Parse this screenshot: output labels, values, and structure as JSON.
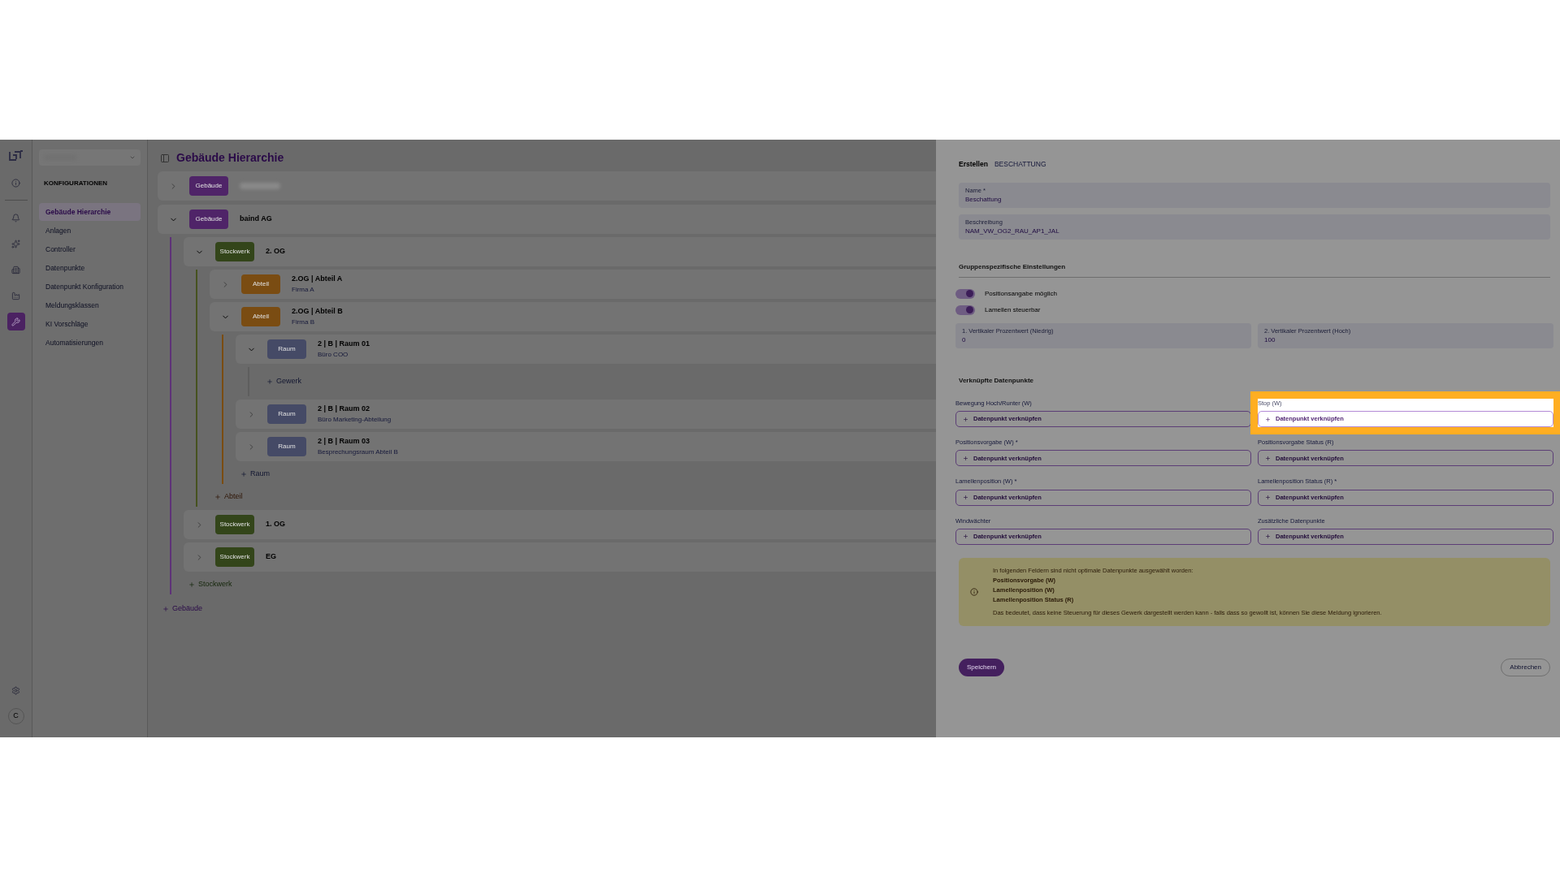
{
  "nav_rail": {
    "items": [
      {
        "kind": "info",
        "selected": false
      },
      {
        "kind": "bell",
        "selected": false
      },
      {
        "kind": "sparkles",
        "selected": false
      },
      {
        "kind": "building",
        "selected": false
      },
      {
        "kind": "factory",
        "selected": false
      },
      {
        "kind": "wrench",
        "selected": true
      }
    ],
    "avatar": "C"
  },
  "nav": {
    "heading": "KONFIGURATIONEN",
    "items": [
      {
        "label": "Gebäude Hierarchie",
        "selected": true
      },
      {
        "label": "Anlagen",
        "selected": false
      },
      {
        "label": "Controller",
        "selected": false
      },
      {
        "label": "Datenpunkte",
        "selected": false
      },
      {
        "label": "Datenpunkt Konfiguration",
        "selected": false
      },
      {
        "label": "Meldungsklassen",
        "selected": false
      },
      {
        "label": "KI Vorschläge",
        "selected": false
      },
      {
        "label": "Automatisierungen",
        "selected": false
      }
    ]
  },
  "page_title": "Gebäude Hierarchie",
  "tree": {
    "nodes": [
      {
        "kind": "gebaeude",
        "badge": "Gebäude",
        "title_redacted": true,
        "expanded": false
      },
      {
        "kind": "gebaeude",
        "badge": "Gebäude",
        "title": "baind AG",
        "expanded": true,
        "add_label": "Stockwerk",
        "children": [
          {
            "kind": "stockwerk",
            "badge": "Stockwerk",
            "title": "2. OG",
            "expanded": true,
            "add_label": "Abteil",
            "children": [
              {
                "kind": "abteil",
                "badge": "Abteil",
                "title": "2.OG | Abteil A",
                "subtitle": "Firma A",
                "expanded": false
              },
              {
                "kind": "abteil",
                "badge": "Abteil",
                "title": "2.OG | Abteil B",
                "subtitle": "Firma B",
                "expanded": true,
                "add_label": "Raum",
                "children": [
                  {
                    "kind": "raum",
                    "badge": "Raum",
                    "title": "2 | B | Raum 01",
                    "subtitle": "Büro COO",
                    "expanded": true,
                    "add_label": "Gewerk"
                  },
                  {
                    "kind": "raum",
                    "badge": "Raum",
                    "title": "2 | B | Raum 02",
                    "subtitle": "Büro Marketing-Abteilung",
                    "expanded": false
                  },
                  {
                    "kind": "raum",
                    "badge": "Raum",
                    "title": "2 | B | Raum 03",
                    "subtitle": "Besprechungsraum Abteil B",
                    "expanded": false
                  }
                ]
              }
            ]
          },
          {
            "kind": "stockwerk",
            "badge": "Stockwerk",
            "title": "1. OG",
            "expanded": false
          },
          {
            "kind": "stockwerk",
            "badge": "Stockwerk",
            "title": "EG",
            "expanded": false
          }
        ]
      }
    ],
    "add_label": "Gebäude"
  },
  "drawer": {
    "breadcrumb": [
      "Erstellen",
      "BESCHATTUNG"
    ],
    "fields": [
      {
        "label": "Name *",
        "value": "Beschattung"
      },
      {
        "label": "Beschreibung",
        "value": "NAM_VW_OG2_RAU_AP1_JAL"
      }
    ],
    "section_title": "Gruppenspezifische Einstellungen",
    "toggles": [
      {
        "label": "Positionsangabe möglich",
        "on": true
      },
      {
        "label": "Lamellen steuerbar",
        "on": true
      }
    ],
    "number_fields": [
      {
        "label": "1. Vertikaler Prozentwert (Niedrig)",
        "value": "0"
      },
      {
        "label": "2. Vertikaler Prozentwert (Hoch)",
        "value": "100"
      }
    ],
    "links_title": "Verknüpfte Datenpunkte",
    "links": [
      {
        "label": "Bewegung Hoch/Runter (W)",
        "button": "Datenpunkt verknüpfen",
        "highlighted": false
      },
      {
        "label": "Stop (W)",
        "button": "Datenpunkt verknüpfen",
        "highlighted": true
      },
      {
        "label": "Positionsvorgabe (W) *",
        "button": "Datenpunkt verknüpfen",
        "highlighted": false
      },
      {
        "label": "Positionsvorgabe Status (R)",
        "button": "Datenpunkt verknüpfen",
        "highlighted": false
      },
      {
        "label": "Lamellenposition (W) *",
        "button": "Datenpunkt verknüpfen",
        "highlighted": false
      },
      {
        "label": "Lamellenposition Status (R) *",
        "button": "Datenpunkt verknüpfen",
        "highlighted": false
      },
      {
        "label": "Windwächter",
        "button": "Datenpunkt verknüpfen",
        "highlighted": false
      },
      {
        "label": "Zusätzliche Datenpunkte",
        "button": "Datenpunkt verknüpfen",
        "highlighted": false
      }
    ],
    "warning": {
      "intro": "In folgenden Feldern sind nicht optimale Datenpunkte ausgewählt worden:",
      "items": [
        "Positionsvorgabe (W)",
        "Lamellenposition (W)",
        "Lamellenposition Status (R)"
      ],
      "note": "Das bedeutet, dass keine Steuerung für dieses Gewerk dargestellt werden kann - falls dass so gewollt ist, können Sie diese Meldung ignorieren."
    },
    "save": "Speichern",
    "cancel": "Abbrechen"
  }
}
